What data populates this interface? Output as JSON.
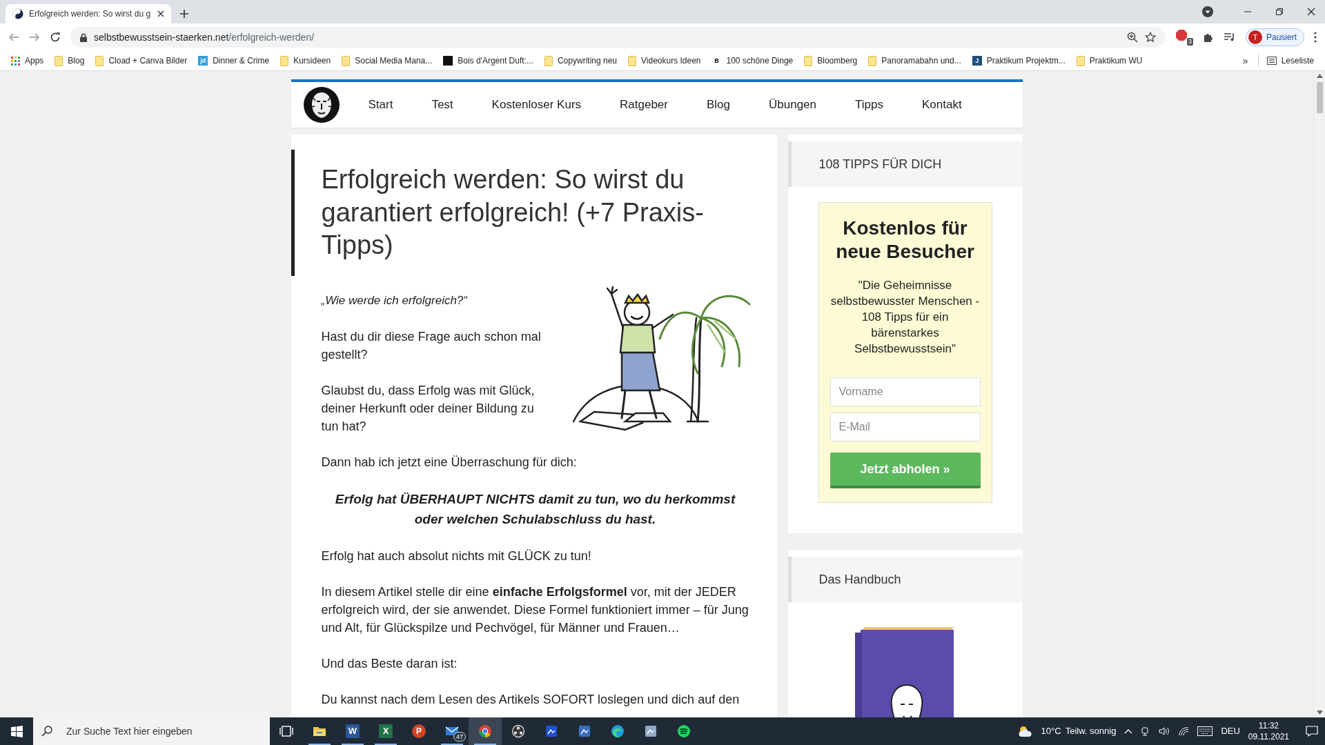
{
  "browser": {
    "tabs": [
      {
        "title": "Erfolgreich werden: So wirst du g",
        "selected": true
      }
    ],
    "address": {
      "domain": "selbstbewusstsein-staerken.net",
      "path": "/erfolgreich-werden/"
    },
    "extensions": {
      "adblock_badge": "3"
    },
    "profile": {
      "initial": "T",
      "label": "Pausiert"
    },
    "bookmarks": [
      {
        "kind": "apps",
        "label": "Apps"
      },
      {
        "kind": "folder",
        "label": "Blog"
      },
      {
        "kind": "folder",
        "label": "Cload + Canva Bilder"
      },
      {
        "kind": "site",
        "favicon": "jd",
        "color": "#2f9fd8",
        "label": "Dinner & Crime"
      },
      {
        "kind": "folder",
        "label": "Kursideen"
      },
      {
        "kind": "folder",
        "label": "Social Media Mana..."
      },
      {
        "kind": "site",
        "color": "#111111",
        "label": "Bois d'Argent Duft:..."
      },
      {
        "kind": "folder",
        "label": "Copywriting neu"
      },
      {
        "kind": "folder",
        "label": "Videokurs Ideen"
      },
      {
        "kind": "site",
        "favicon": "B",
        "color": "#ffffff",
        "label": "100 schöne Dinge"
      },
      {
        "kind": "folder",
        "label": "Bloomberg"
      },
      {
        "kind": "folder",
        "label": "Panoramabahn und..."
      },
      {
        "kind": "site",
        "favicon": "J",
        "color": "#1f4e79",
        "label": "Praktikum Projektm..."
      },
      {
        "kind": "folder",
        "label": "Praktikum WU"
      }
    ],
    "overflow": "»",
    "reading_list": "Leseliste"
  },
  "site": {
    "nav": [
      "Start",
      "Test",
      "Kostenloser Kurs",
      "Ratgeber",
      "Blog",
      "Übungen",
      "Tipps",
      "Kontakt"
    ],
    "article": {
      "title": "Erfolgreich werden: So wirst du garantiert erfolgreich! (+7 Praxis-Tipps)",
      "paragraphs": [
        {
          "kind": "quote",
          "text": "„Wie werde ich erfolgreich?“"
        },
        {
          "kind": "text",
          "text": "Hast du dir diese Frage auch schon mal gestellt?"
        },
        {
          "kind": "text",
          "text": "Glaubst du, dass Erfolg was mit Glück, deiner Herkunft oder deiner Bildung zu tun hat?"
        },
        {
          "kind": "text",
          "text": "Dann hab ich jetzt eine Überraschung für dich:"
        },
        {
          "kind": "highlight",
          "text": "Erfolg hat ÜBERHAUPT NICHTS damit zu tun, wo du herkommst oder welchen Schulabschluss du hast."
        },
        {
          "kind": "text",
          "text": "Erfolg hat auch absolut nichts mit GLÜCK zu tun!"
        },
        {
          "kind": "text",
          "text": "In diesem Artikel stelle dir eine **einfache Erfolgsformel** vor, mit der JEDER erfolgreich wird, der sie anwendet. Diese Formel funktioniert immer – für Jung und Alt, für Glückspilze und Pechvögel, für Männer und Frauen…"
        },
        {
          "kind": "text",
          "text": "Und das Beste daran ist:"
        },
        {
          "kind": "text",
          "text": "Du kannst nach dem Lesen des Artikels SOFORT loslegen und dich auf den"
        }
      ]
    },
    "sidebar": {
      "optin": {
        "title": "108 TIPPS FÜR DICH",
        "heading": "Kostenlos für neue Besucher",
        "text": "\"Die Geheimnisse selbstbewusster Menschen - 108 Tipps für ein bärenstarkes Selbstbewusstsein\"",
        "fields": [
          {
            "placeholder": "Vorname"
          },
          {
            "placeholder": "E-Mail"
          }
        ],
        "button": "Jetzt abholen »"
      },
      "book": {
        "title": "Das Handbuch"
      }
    }
  },
  "taskbar": {
    "search": {
      "placeholder": "Zur Suche Text hier eingeben"
    },
    "apps": [
      {
        "kind": "taskview",
        "running": false,
        "selected": false
      },
      {
        "kind": "folder",
        "running": true,
        "selected": false
      },
      {
        "kind": "tile",
        "glyph": "W",
        "color": "#2b579a",
        "running": true,
        "selected": false
      },
      {
        "kind": "tile",
        "glyph": "X",
        "color": "#217346",
        "running": true,
        "selected": false
      },
      {
        "kind": "round",
        "glyph": "P",
        "color": "#d04423",
        "running": false,
        "selected": false
      },
      {
        "kind": "mail",
        "badge": "47",
        "running": true,
        "selected": false
      },
      {
        "kind": "chrome",
        "running": true,
        "selected": true
      },
      {
        "kind": "ring",
        "running": false,
        "selected": false
      },
      {
        "kind": "app",
        "color": "#1d4fd8",
        "running": false,
        "selected": false
      },
      {
        "kind": "app",
        "color": "#3a6fc0",
        "running": false,
        "selected": false
      },
      {
        "kind": "edge",
        "running": false,
        "selected": false
      },
      {
        "kind": "app",
        "color": "#8fa8c8",
        "running": false,
        "selected": false
      },
      {
        "kind": "spotify",
        "running": false,
        "selected": false
      }
    ],
    "weather": {
      "temp": "10°C",
      "text": "Teilw. sonnig"
    },
    "language": "DEU",
    "time": "11:32",
    "date": "09.11.2021"
  }
}
